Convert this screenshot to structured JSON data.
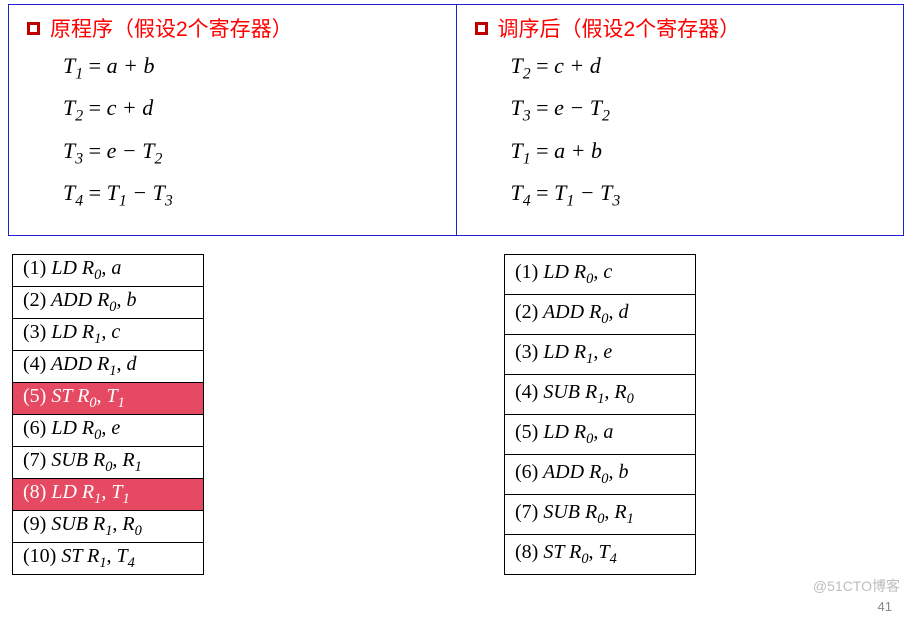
{
  "left_panel": {
    "title": "原程序（假设2个寄存器）",
    "equations": [
      {
        "lhs_base": "T",
        "lhs_sub": "1",
        "rhs": "a + b"
      },
      {
        "lhs_base": "T",
        "lhs_sub": "2",
        "rhs": "c + d"
      },
      {
        "lhs_base": "T",
        "lhs_sub": "3",
        "rhs_html": "e − T<sub>2</sub>"
      },
      {
        "lhs_base": "T",
        "lhs_sub": "4",
        "rhs_html": "T<sub>1</sub> − T<sub>3</sub>"
      }
    ]
  },
  "right_panel": {
    "title": "调序后（假设2个寄存器）",
    "equations": [
      {
        "lhs_base": "T",
        "lhs_sub": "2",
        "rhs": "c + d"
      },
      {
        "lhs_base": "T",
        "lhs_sub": "3",
        "rhs_html": "e − T<sub>2</sub>"
      },
      {
        "lhs_base": "T",
        "lhs_sub": "1",
        "rhs": "a + b"
      },
      {
        "lhs_base": "T",
        "lhs_sub": "4",
        "rhs_html": "T<sub>1</sub> − T<sub>3</sub>"
      }
    ]
  },
  "left_table": [
    {
      "n": "1",
      "op": "LD",
      "a1": "R",
      "s1": "0",
      "a2": "a",
      "hl": false
    },
    {
      "n": "2",
      "op": "ADD",
      "a1": "R",
      "s1": "0",
      "a2": "b",
      "hl": false
    },
    {
      "n": "3",
      "op": "LD",
      "a1": "R",
      "s1": "1",
      "a2": "c",
      "hl": false
    },
    {
      "n": "4",
      "op": "ADD",
      "a1": "R",
      "s1": "1",
      "a2": "d",
      "hl": false
    },
    {
      "n": "5",
      "op": "ST",
      "a1": "R",
      "s1": "0",
      "a2": "T",
      "s2": "1",
      "hl": true
    },
    {
      "n": "6",
      "op": "LD",
      "a1": "R",
      "s1": "0",
      "a2": "e",
      "hl": false
    },
    {
      "n": "7",
      "op": "SUB",
      "a1": "R",
      "s1": "0",
      "a2": "R",
      "s2": "1",
      "hl": false
    },
    {
      "n": "8",
      "op": "LD",
      "a1": "R",
      "s1": "1",
      "a2": "T",
      "s2": "1",
      "hl": true
    },
    {
      "n": "9",
      "op": "SUB",
      "a1": "R",
      "s1": "1",
      "a2": "R",
      "s2": "0",
      "hl": false
    },
    {
      "n": "10",
      "op": "ST",
      "a1": "R",
      "s1": "1",
      "a2": "T",
      "s2": "4",
      "hl": false
    }
  ],
  "right_table": [
    {
      "n": "1",
      "op": "LD",
      "a1": "R",
      "s1": "0",
      "a2": "c"
    },
    {
      "n": "2",
      "op": "ADD",
      "a1": "R",
      "s1": "0",
      "a2": "d"
    },
    {
      "n": "3",
      "op": "LD",
      "a1": "R",
      "s1": "1",
      "a2": "e"
    },
    {
      "n": "4",
      "op": "SUB",
      "a1": "R",
      "s1": "1",
      "a2": "R",
      "s2": "0"
    },
    {
      "n": "5",
      "op": "LD",
      "a1": "R",
      "s1": "0",
      "a2": "a"
    },
    {
      "n": "6",
      "op": "ADD",
      "a1": "R",
      "s1": "0",
      "a2": "b"
    },
    {
      "n": "7",
      "op": "SUB",
      "a1": "R",
      "s1": "0",
      "a2": "R",
      "s2": "1"
    },
    {
      "n": "8",
      "op": "ST",
      "a1": "R",
      "s1": "0",
      "a2": "T",
      "s2": "4"
    }
  ],
  "watermark": "@51CTO博客",
  "page_number": "41"
}
